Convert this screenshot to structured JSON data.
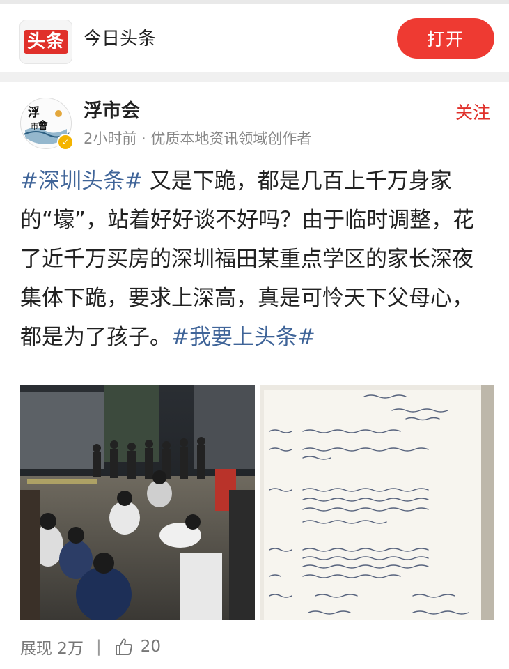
{
  "app_bar": {
    "logo_text": "头条",
    "app_name": "今日头条",
    "open_label": "打开"
  },
  "author": {
    "name": "浮市会",
    "avatar_text": "浮市會",
    "meta": "2小时前 · 优质本地资讯领域创作者",
    "follow_label": "关注"
  },
  "post": {
    "hashtag_1": "#深圳头条#",
    "body": " 又是下跪，都是几百上千万身家的“壕”，站着好好谈不好吗？由于临时调整，花了近千万买房的深圳福田某重点学区的家长深夜集体下跪，要求上深高，真是可怜天下父母心，都是为了孩子。",
    "hashtag_2": "#我要上头条#"
  },
  "images": [
    {
      "alt": "photo-parents-kneeling"
    },
    {
      "alt": "photo-handwritten-letter"
    }
  ],
  "footer": {
    "views": "展现 2万",
    "divider": "|",
    "likes": "20"
  },
  "colors": {
    "brand_red": "#e0302a",
    "hashtag_blue": "#406599"
  }
}
